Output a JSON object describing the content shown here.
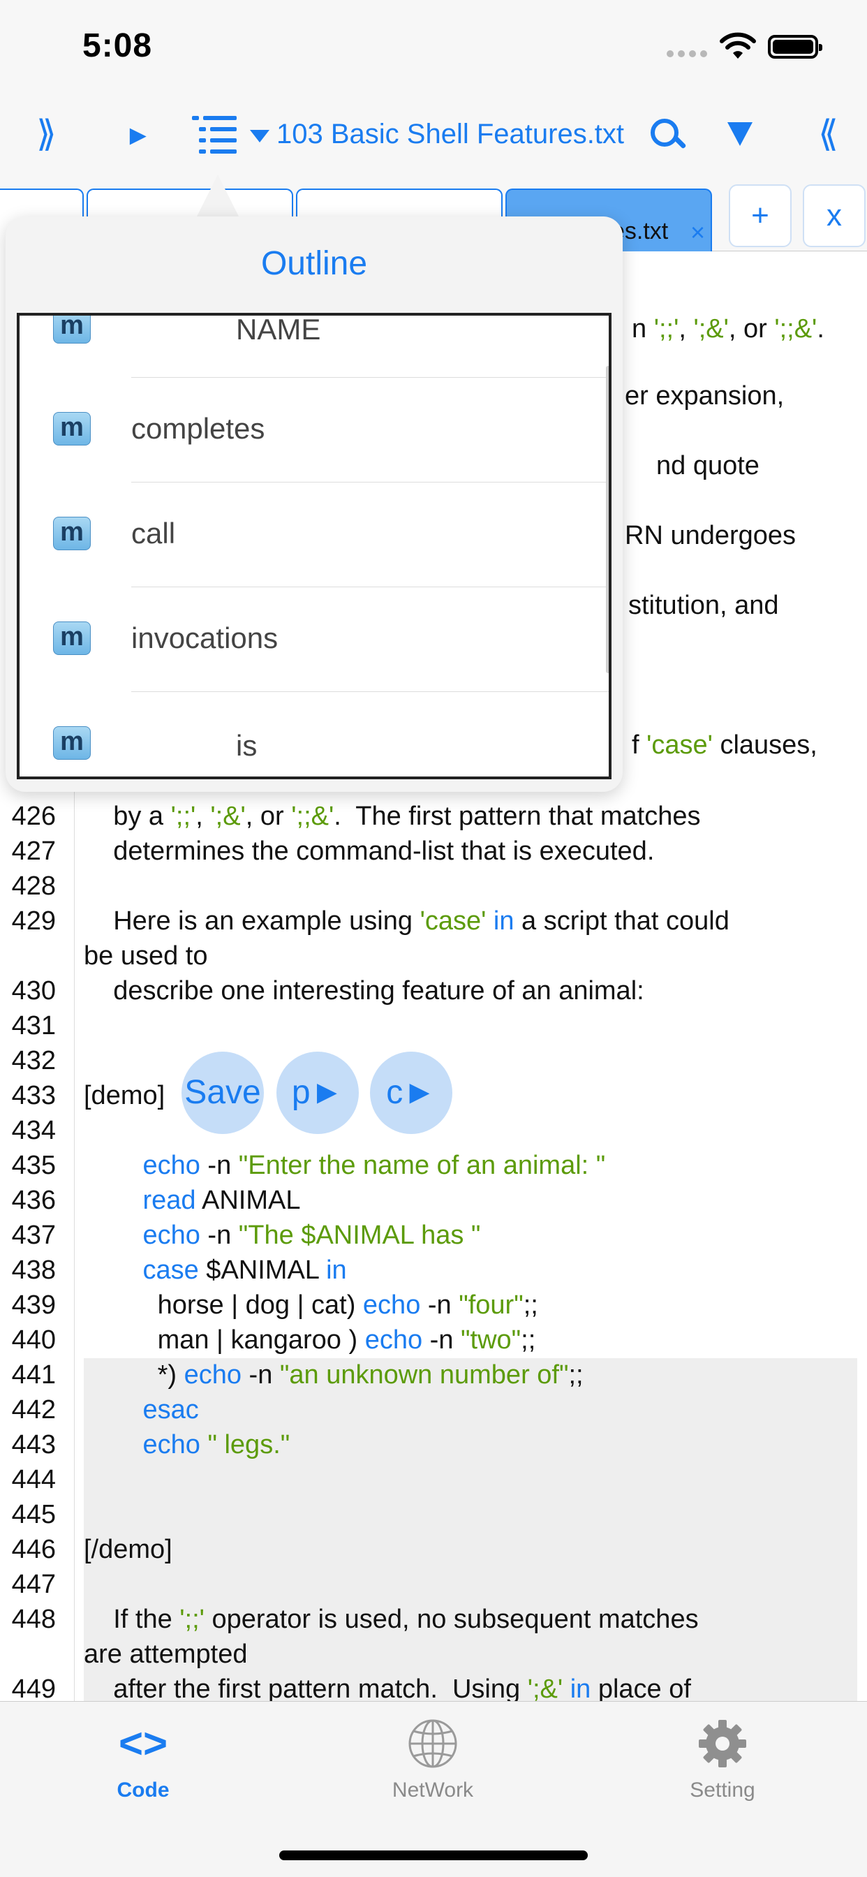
{
  "status": {
    "time": "5:08"
  },
  "toolbar": {
    "prev_icon": "⟫",
    "play_icon": "►",
    "file_title": "103 Basic Shell Features.txt",
    "next_icon": "⟪"
  },
  "tabs": {
    "active_label": "103 Basic Shell Features.txt",
    "active_visible": "es.txt",
    "close": "×",
    "add": "+",
    "close_all": "x"
  },
  "editor": {
    "lines": [
      {
        "n": "426",
        "parts": [
          {
            "t": "    by a ",
            "c": ""
          },
          {
            "t": "';;'",
            "c": "g"
          },
          {
            "t": ", ",
            "c": ""
          },
          {
            "t": "';&'",
            "c": "g"
          },
          {
            "t": ", or ",
            "c": ""
          },
          {
            "t": "';;&'",
            "c": "g"
          },
          {
            "t": ".  The first pattern that matches",
            "c": ""
          }
        ]
      },
      {
        "n": "427",
        "parts": [
          {
            "t": "    determines the command-list that is executed.",
            "c": ""
          }
        ]
      },
      {
        "n": "428",
        "parts": []
      },
      {
        "n": "429",
        "parts": [
          {
            "t": "    Here is an example using ",
            "c": ""
          },
          {
            "t": "'case'",
            "c": "g"
          },
          {
            "t": " ",
            "c": ""
          },
          {
            "t": "in",
            "c": "b"
          },
          {
            "t": " a script that could",
            "c": ""
          }
        ]
      },
      {
        "n": "",
        "parts": [
          {
            "t": "be used to",
            "c": ""
          }
        ]
      },
      {
        "n": "430",
        "parts": [
          {
            "t": "    describe one interesting feature of an animal:",
            "c": ""
          }
        ]
      },
      {
        "n": "431",
        "parts": []
      },
      {
        "n": "432",
        "parts": []
      },
      {
        "n": "433",
        "parts": [
          {
            "t": "[demo]",
            "c": ""
          }
        ]
      },
      {
        "n": "434",
        "parts": []
      },
      {
        "n": "435",
        "parts": [
          {
            "t": "        ",
            "c": ""
          },
          {
            "t": "echo",
            "c": "b"
          },
          {
            "t": " -n ",
            "c": ""
          },
          {
            "t": "\"Enter the name of an animal: \"",
            "c": "g"
          }
        ]
      },
      {
        "n": "436",
        "parts": [
          {
            "t": "        ",
            "c": ""
          },
          {
            "t": "read",
            "c": "b"
          },
          {
            "t": " ANIMAL",
            "c": ""
          }
        ]
      },
      {
        "n": "437",
        "parts": [
          {
            "t": "        ",
            "c": ""
          },
          {
            "t": "echo",
            "c": "b"
          },
          {
            "t": " -n ",
            "c": ""
          },
          {
            "t": "\"The $ANIMAL has \"",
            "c": "g"
          }
        ]
      },
      {
        "n": "438",
        "parts": [
          {
            "t": "        ",
            "c": ""
          },
          {
            "t": "case",
            "c": "b"
          },
          {
            "t": " $ANIMAL ",
            "c": ""
          },
          {
            "t": "in",
            "c": "b"
          }
        ]
      },
      {
        "n": "439",
        "parts": [
          {
            "t": "          horse | dog | cat) ",
            "c": ""
          },
          {
            "t": "echo",
            "c": "b"
          },
          {
            "t": " -n ",
            "c": ""
          },
          {
            "t": "\"four\"",
            "c": "g"
          },
          {
            "t": ";;",
            "c": ""
          }
        ]
      },
      {
        "n": "440",
        "parts": [
          {
            "t": "          man | kangaroo ) ",
            "c": ""
          },
          {
            "t": "echo",
            "c": "b"
          },
          {
            "t": " -n ",
            "c": ""
          },
          {
            "t": "\"two\"",
            "c": "g"
          },
          {
            "t": ";;",
            "c": ""
          }
        ]
      },
      {
        "n": "441",
        "parts": [
          {
            "t": "          *) ",
            "c": ""
          },
          {
            "t": "echo",
            "c": "b"
          },
          {
            "t": " -n ",
            "c": ""
          },
          {
            "t": "\"an unknown number of\"",
            "c": "g"
          },
          {
            "t": ";;",
            "c": ""
          }
        ]
      },
      {
        "n": "442",
        "parts": [
          {
            "t": "        ",
            "c": ""
          },
          {
            "t": "esac",
            "c": "b"
          }
        ]
      },
      {
        "n": "443",
        "parts": [
          {
            "t": "        ",
            "c": ""
          },
          {
            "t": "echo",
            "c": "b"
          },
          {
            "t": " ",
            "c": ""
          },
          {
            "t": "\" legs.\"",
            "c": "g"
          }
        ]
      },
      {
        "n": "444",
        "parts": []
      },
      {
        "n": "445",
        "parts": []
      },
      {
        "n": "446",
        "parts": [
          {
            "t": "[/demo]",
            "c": ""
          }
        ]
      },
      {
        "n": "447",
        "parts": []
      },
      {
        "n": "448",
        "parts": [
          {
            "t": "    If the ",
            "c": ""
          },
          {
            "t": "';;'",
            "c": "g"
          },
          {
            "t": " operator is used, no subsequent matches",
            "c": ""
          }
        ]
      },
      {
        "n": "",
        "parts": [
          {
            "t": "are attempted",
            "c": ""
          }
        ]
      },
      {
        "n": "449",
        "parts": [
          {
            "t": "    after the first pattern match.  Using ",
            "c": ""
          },
          {
            "t": "';&'",
            "c": "g"
          },
          {
            "t": " ",
            "c": ""
          },
          {
            "t": "in",
            "c": "b"
          },
          {
            "t": " place of",
            "c": ""
          }
        ]
      }
    ],
    "behind_popover": [
      {
        "parts": [
          {
            "t": "n ",
            "c": ""
          },
          {
            "t": "';;'",
            "c": "g"
          },
          {
            "t": ", ",
            "c": ""
          },
          {
            "t": "';&'",
            "c": "g"
          },
          {
            "t": ", or ",
            "c": ""
          },
          {
            "t": "';;&'",
            "c": "g"
          },
          {
            "t": ".",
            "c": ""
          }
        ]
      },
      {
        "parts": [
          {
            "t": "er expansion,",
            "c": ""
          }
        ]
      },
      {
        "parts": [
          {
            "t": "nd quote",
            "c": ""
          }
        ]
      },
      {
        "parts": [
          {
            "t": "RN undergoes",
            "c": ""
          }
        ]
      },
      {
        "parts": [
          {
            "t": "stitution, and",
            "c": ""
          }
        ]
      },
      {
        "parts": [
          {
            "t": "f ",
            "c": ""
          },
          {
            "t": "'case'",
            "c": "g"
          },
          {
            "t": " clauses,",
            "c": ""
          }
        ]
      }
    ]
  },
  "demo_buttons": {
    "save": "Save",
    "p": "p►",
    "c": "c►"
  },
  "outline": {
    "title": "Outline",
    "items": [
      {
        "icon": "m",
        "label": "NAME"
      },
      {
        "icon": "m",
        "label": "completes"
      },
      {
        "icon": "m",
        "label": "call"
      },
      {
        "icon": "m",
        "label": "invocations"
      },
      {
        "icon": "m",
        "label": "is"
      }
    ]
  },
  "tabbar": {
    "code": {
      "icon": "<>",
      "label": "Code"
    },
    "network": {
      "label": "NetWork"
    },
    "setting": {
      "label": "Setting"
    }
  }
}
